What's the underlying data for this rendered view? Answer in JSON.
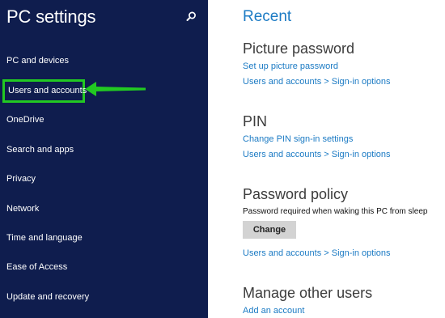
{
  "sidebar": {
    "title": "PC settings",
    "items": [
      {
        "label": "PC and devices"
      },
      {
        "label": "Users and accounts"
      },
      {
        "label": "OneDrive"
      },
      {
        "label": "Search and apps"
      },
      {
        "label": "Privacy"
      },
      {
        "label": "Network"
      },
      {
        "label": "Time and language"
      },
      {
        "label": "Ease of Access"
      },
      {
        "label": "Update and recovery"
      }
    ],
    "selected_index": 1
  },
  "main": {
    "heading": "Recent",
    "picture_password": {
      "title": "Picture password",
      "link1": "Set up picture password",
      "link2": "Users and accounts > Sign-in options"
    },
    "pin": {
      "title": "PIN",
      "link1": "Change PIN sign-in settings",
      "link2": "Users and accounts > Sign-in options"
    },
    "password_policy": {
      "title": "Password policy",
      "description": "Password required when waking this PC from sleep",
      "button": "Change",
      "link": "Users and accounts > Sign-in options"
    },
    "manage_users": {
      "title": "Manage other users",
      "link": "Add an account"
    }
  },
  "colors": {
    "sidebar_bg": "#0f1d4e",
    "accent": "#1c7bc4",
    "highlight": "#22c922"
  },
  "icons": {
    "search": "search-icon",
    "annotation": "arrow-left-icon"
  }
}
